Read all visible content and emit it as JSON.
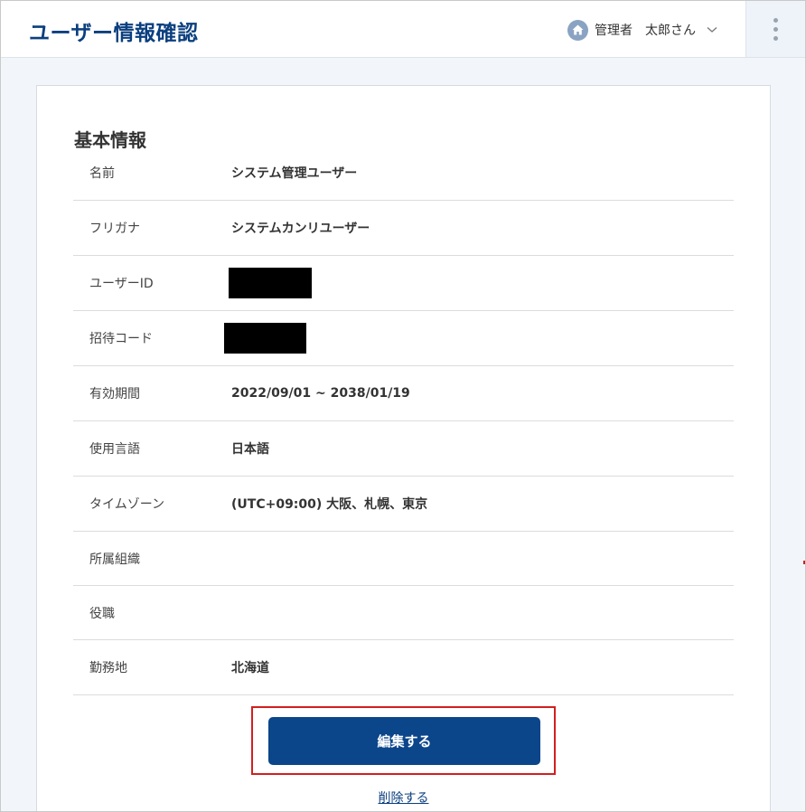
{
  "header": {
    "title": "ユーザー情報確認",
    "role": "管理者",
    "user_name": "太郎さん"
  },
  "section": {
    "title": "基本情報"
  },
  "rows": [
    {
      "label": "名前",
      "value": "システム管理ユーザー"
    },
    {
      "label": "フリガナ",
      "value": "システムカンリユーザー"
    },
    {
      "label": "ユーザーID",
      "value": ""
    },
    {
      "label": "招待コード",
      "value": ""
    },
    {
      "label": "有効期間",
      "value": "2022/09/01 ~ 2038/01/19"
    },
    {
      "label": "使用言語",
      "value": "日本語"
    },
    {
      "label": "タイムゾーン",
      "value": "(UTC+09:00) 大阪、札幌、東京"
    },
    {
      "label": "所属組織",
      "value": ""
    },
    {
      "label": "役職",
      "value": ""
    },
    {
      "label": "勤務地",
      "value": "北海道"
    }
  ],
  "actions": {
    "edit_label": "編集する",
    "delete_label": "削除する"
  },
  "colors": {
    "brand": "#0b3f7f",
    "button": "#0b458a",
    "highlight": "#d21f1f"
  },
  "icons": {
    "home": "home-icon",
    "chevron": "chevron-down-icon",
    "menu": "kebab-menu-icon"
  }
}
